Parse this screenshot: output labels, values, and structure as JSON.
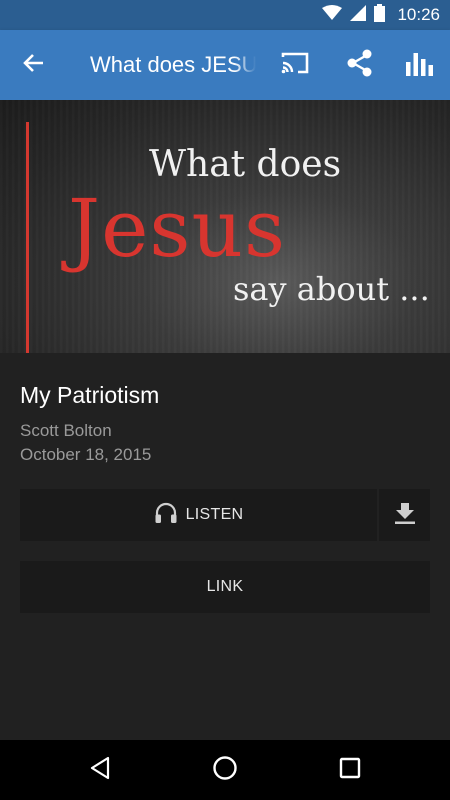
{
  "status_bar": {
    "time": "10:26",
    "icons": [
      "wifi-icon",
      "signal-icon",
      "battery-icon"
    ]
  },
  "app_bar": {
    "title": "What does JESUS say about ...",
    "actions": [
      "back-arrow-icon",
      "cast-icon",
      "share-icon",
      "bar-chart-icon"
    ]
  },
  "hero": {
    "line1": "What does",
    "line2": "Jesus",
    "line3": "say about ..."
  },
  "sermon": {
    "title": "My Patriotism",
    "author": "Scott Bolton",
    "date": "October 18, 2015"
  },
  "actions": {
    "listen_label": "LISTEN",
    "link_label": "LINK"
  },
  "nav_bar": {
    "icons": [
      "nav-back-icon",
      "nav-home-icon",
      "nav-recents-icon"
    ]
  },
  "colors": {
    "app_bar": "#3a7bbf",
    "status_bar": "#2b5e91",
    "background": "#212121",
    "button": "#1a1a1a",
    "accent_red": "#d8352f"
  }
}
